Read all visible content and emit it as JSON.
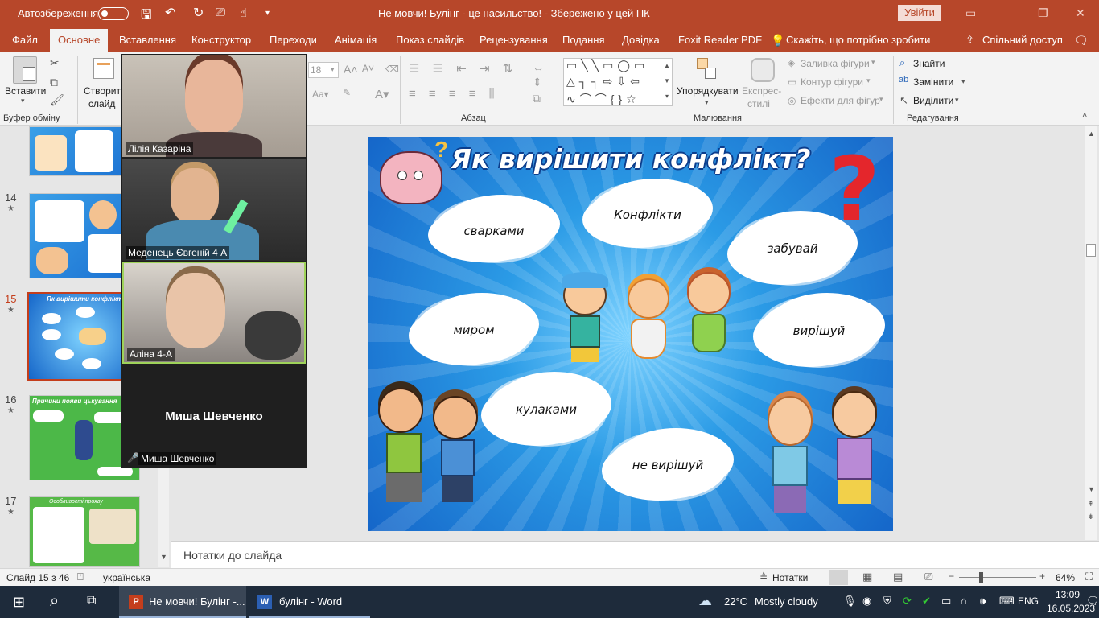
{
  "titlebar": {
    "autosave_label": "Автозбереження",
    "document_title": "Не мовчи! Булінг - це насильство!  -  Збережено у цей ПК",
    "signin_label": "Увійти",
    "brand_color": "#b7472a"
  },
  "menu": {
    "tabs": [
      "Файл",
      "Основне",
      "Вставлення",
      "Конструктор",
      "Переходи",
      "Анімація",
      "Показ слайдів",
      "Рецензування",
      "Подання",
      "Довідка",
      "Foxit Reader PDF"
    ],
    "active_tab": "Основне",
    "tell_me": "Скажіть, що потрібно зробити",
    "share": "Спільний доступ"
  },
  "ribbon": {
    "paste_label": "Вставити",
    "clipboard_group": "Буфер обміну",
    "new_slide_label_1": "Створити",
    "new_slide_label_2": "слайд",
    "font_size": "18",
    "paragraph_group": "Абзац",
    "drawing_group": "Малювання",
    "arrange_label": "Упорядкувати",
    "quick_styles_1": "Експрес-",
    "quick_styles_2": "стилі",
    "shape_fill": "Заливка фігури",
    "shape_outline": "Контур фігури",
    "shape_effects": "Ефекти для фігур",
    "find": "Знайти",
    "replace": "Замінити",
    "select": "Виділити",
    "editing_group": "Редагування"
  },
  "slides_panel": {
    "items": [
      {
        "number": "14"
      },
      {
        "number": "15"
      },
      {
        "number": "16"
      },
      {
        "number": "17"
      }
    ],
    "thumb_15_title": "Як вирішити конфлікт?",
    "thumb_16_title": "Причини появи цькування",
    "thumb_17_title": "Особливості прояву"
  },
  "slide": {
    "title": "Як вирішити конфлікт?",
    "clouds": [
      "сварками",
      "Конфлікти",
      "забувай",
      "миром",
      "вирішуй",
      "кулаками",
      "не вирішуй"
    ]
  },
  "video": {
    "participants": [
      "Лілія Казаріна",
      "Меденець Євгеній 4 А",
      "Аліна 4-А",
      "Миша Шевченко"
    ],
    "no_video_name": "Миша Шевченко"
  },
  "notes": {
    "placeholder": "Нотатки до слайда"
  },
  "status": {
    "slide_counter": "Слайд 15 з 46",
    "language": "українська",
    "notes_button": "Нотатки",
    "zoom": "64%"
  },
  "taskbar": {
    "app1": "Не мовчи! Булінг -...",
    "app2": "булінг - Word",
    "weather_temp": "22°C",
    "weather_desc": "Mostly cloudy",
    "lang": "ENG",
    "time": "13:09",
    "date": "16.05.2023"
  }
}
